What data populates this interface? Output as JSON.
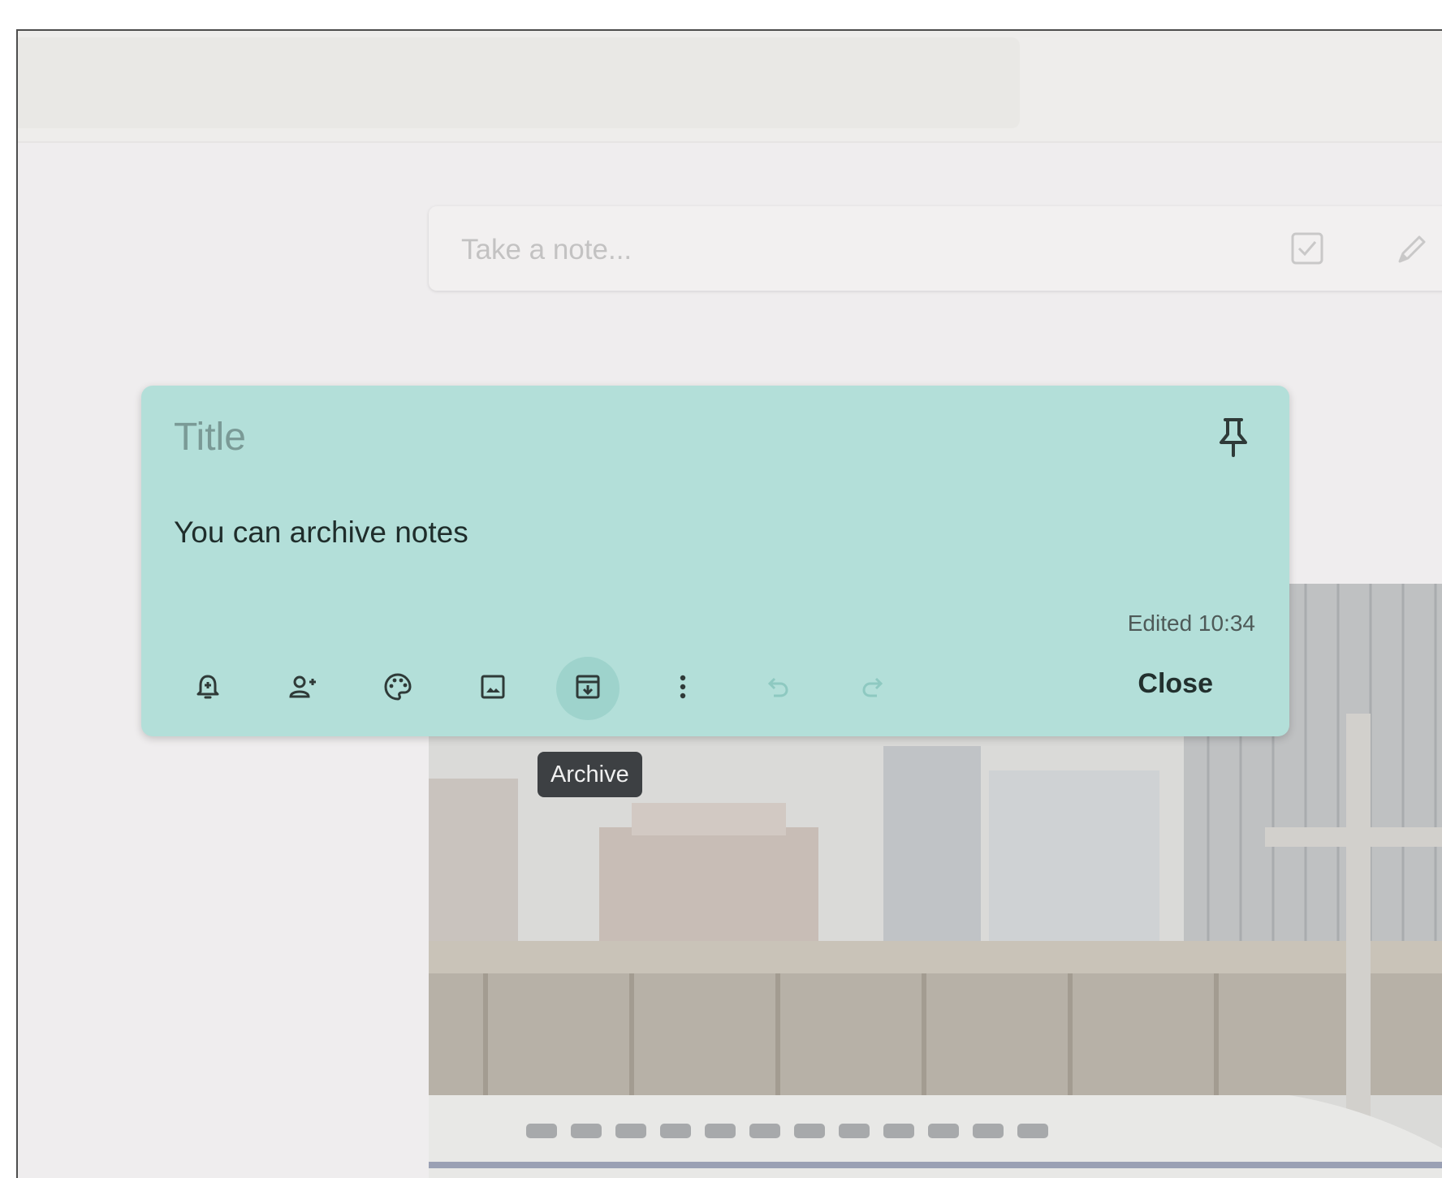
{
  "take_note": {
    "placeholder": "Take a note..."
  },
  "note": {
    "title_placeholder": "Title",
    "body": "You can archive notes",
    "edited": "Edited 10:34",
    "close_label": "Close",
    "color": "#b3dfd9"
  },
  "toolbar": {
    "icons": [
      "remind-me-icon",
      "collaborator-icon",
      "palette-icon",
      "add-image-icon",
      "archive-icon",
      "more-icon",
      "undo-icon",
      "redo-icon"
    ]
  },
  "tooltip": {
    "label": "Archive"
  }
}
